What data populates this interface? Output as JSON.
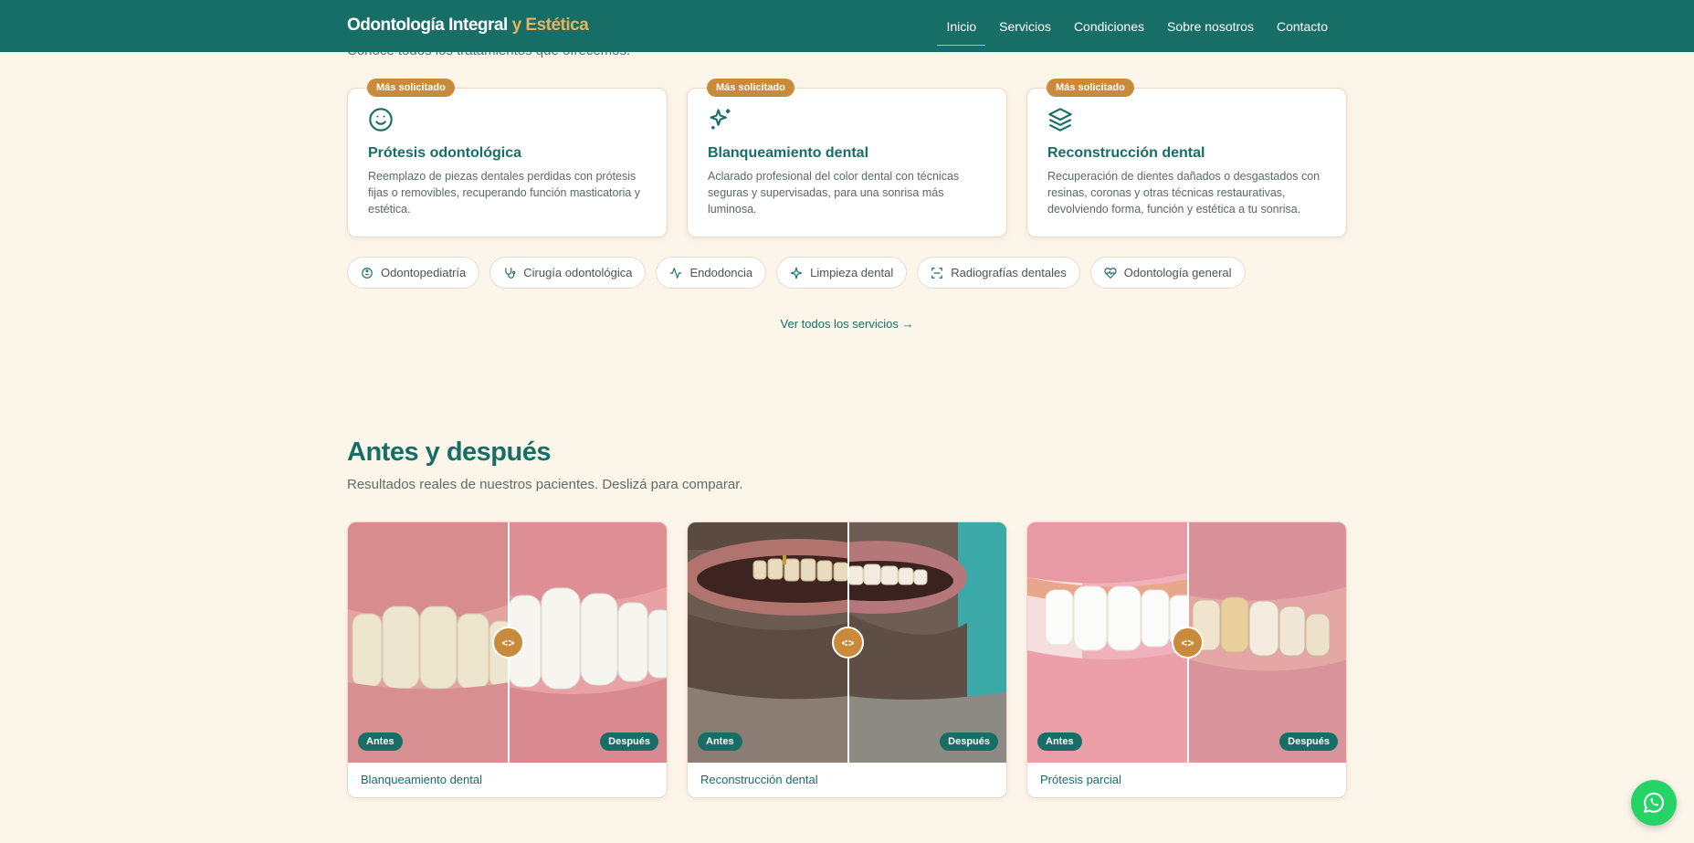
{
  "header": {
    "brand_main": "Odontología Integral",
    "brand_accent": "y Estética",
    "nav": [
      "Inicio",
      "Servicios",
      "Condiciones",
      "Sobre nosotros",
      "Contacto"
    ]
  },
  "services": {
    "subtitle": "Conocé todos los tratamientos que ofrecemos.",
    "cards": [
      {
        "badge": "Más solicitado",
        "icon": "smile-icon",
        "title": "Prótesis odontológica",
        "desc": "Reemplazo de piezas dentales perdidas con prótesis fijas o removibles, recuperando función masticatoria y estética."
      },
      {
        "badge": "Más solicitado",
        "icon": "sparkles-icon",
        "title": "Blanqueamiento dental",
        "desc": "Aclarado profesional del color dental con técnicas seguras y supervisadas, para una sonrisa más luminosa."
      },
      {
        "badge": "Más solicitado",
        "icon": "layers-icon",
        "title": "Reconstrucción dental",
        "desc": "Recuperación de dientes dañados o desgastados con resinas, coronas y otras técnicas restaurativas, devolviendo forma, función y estética a tu sonrisa."
      }
    ],
    "chips": [
      {
        "label": "Odontopediatría",
        "icon": "baby-icon"
      },
      {
        "label": "Cirugía odontológica",
        "icon": "stethoscope-icon"
      },
      {
        "label": "Endodoncia",
        "icon": "activity-icon"
      },
      {
        "label": "Limpieza dental",
        "icon": "sparkle-icon"
      },
      {
        "label": "Radiografías dentales",
        "icon": "scan-icon"
      },
      {
        "label": "Odontología general",
        "icon": "heart-pulse-icon"
      }
    ],
    "see_all": "Ver todos los servicios →"
  },
  "before_after": {
    "title": "Antes y después",
    "subtitle": "Resultados reales de nuestros pacientes. Deslizá para comparar.",
    "before_label": "Antes",
    "after_label": "Después",
    "handle": "<>",
    "cases": [
      {
        "caption": "Blanqueamiento dental"
      },
      {
        "caption": "Reconstrucción dental"
      },
      {
        "caption": "Prótesis parcial"
      }
    ]
  },
  "colors": {
    "primary": "#176e66",
    "accent": "#c98a3b",
    "background": "#fcf5ea",
    "whatsapp": "#25d366"
  }
}
